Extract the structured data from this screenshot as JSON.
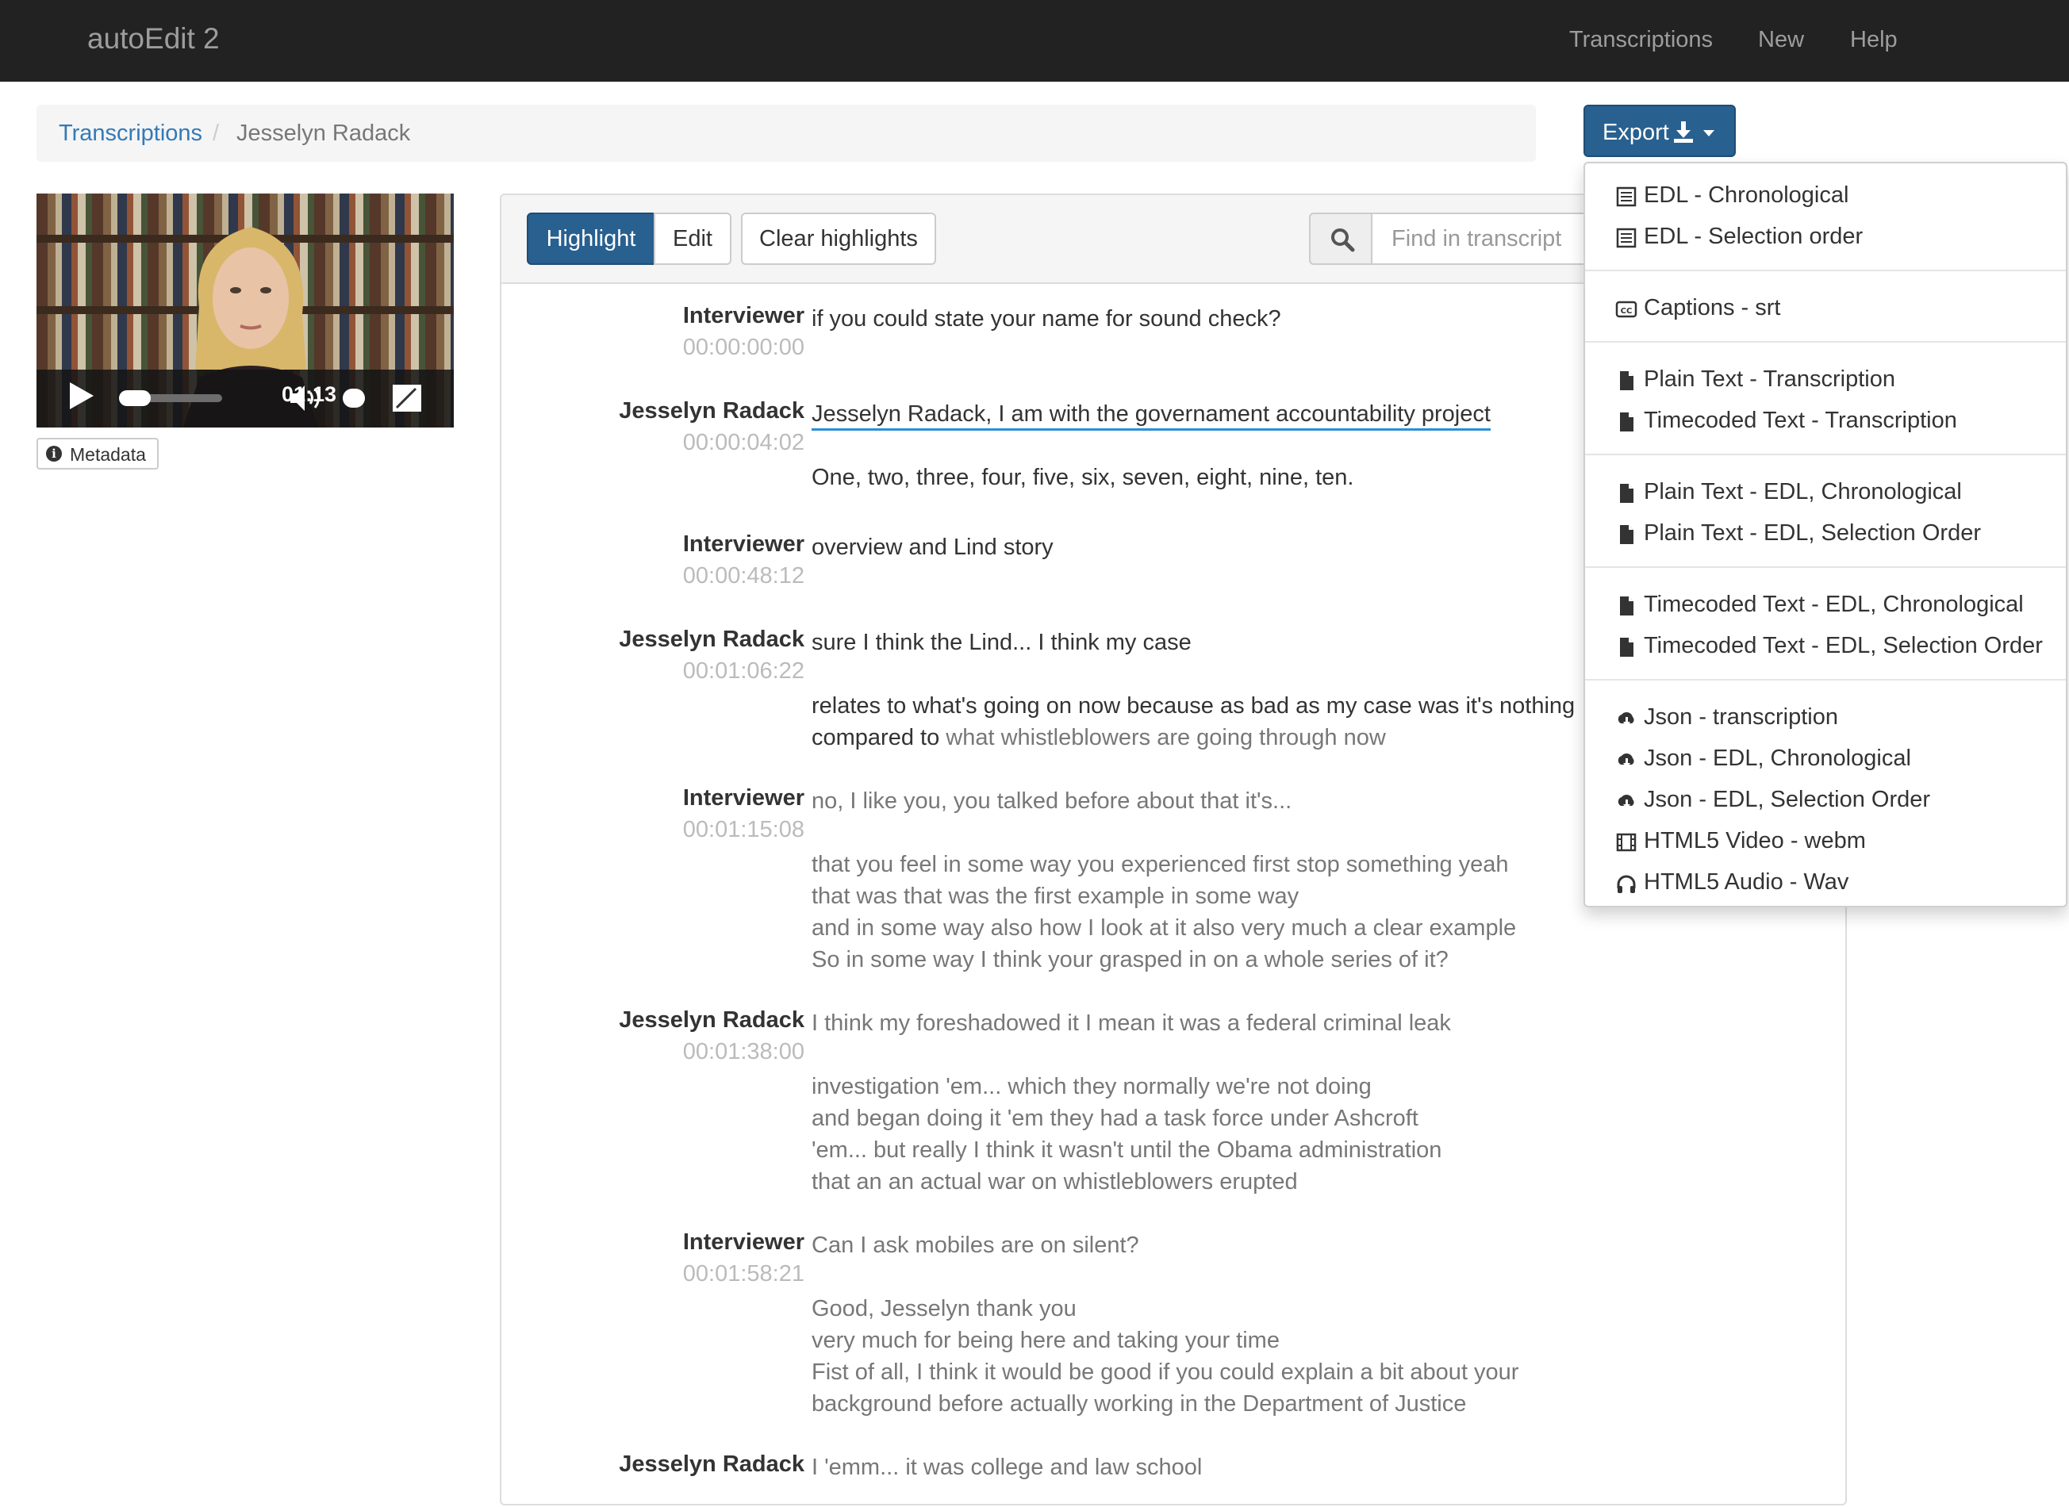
{
  "navbar": {
    "brand": "autoEdit 2",
    "links": [
      "Transcriptions",
      "New",
      "Help"
    ]
  },
  "breadcrumb": {
    "link": "Transcriptions",
    "separator": "/",
    "active": "Jesselyn Radack"
  },
  "export": {
    "label": "Export",
    "items": [
      {
        "icon": "list-icon",
        "label": "EDL - Chronological"
      },
      {
        "icon": "list-icon",
        "label": "EDL - Selection order"
      },
      {
        "icon": "captions-icon",
        "label": "Captions - srt"
      },
      {
        "icon": "file-icon",
        "label": "Plain Text - Transcription"
      },
      {
        "icon": "file-icon",
        "label": "Timecoded Text - Transcription"
      },
      {
        "icon": "file-icon",
        "label": "Plain Text - EDL, Chronological"
      },
      {
        "icon": "file-icon",
        "label": "Plain Text - EDL, Selection Order"
      },
      {
        "icon": "file-icon",
        "label": "Timecoded Text - EDL, Chronological"
      },
      {
        "icon": "file-icon",
        "label": "Timecoded Text - EDL, Selection Order"
      },
      {
        "icon": "cloud-download-icon",
        "label": "Json - transcription"
      },
      {
        "icon": "cloud-download-icon",
        "label": "Json - EDL, Chronological"
      },
      {
        "icon": "cloud-download-icon",
        "label": "Json - EDL, Selection Order"
      },
      {
        "icon": "film-icon",
        "label": "HTML5 Video - webm"
      },
      {
        "icon": "headphones-icon",
        "label": "HTML5 Audio - Wav"
      }
    ]
  },
  "video": {
    "time": "01:13"
  },
  "metadata_button": "Metadata",
  "toolbar": {
    "highlight": "Highlight",
    "edit": "Edit",
    "clear": "Clear highlights",
    "search_placeholder": "Find in transcript"
  },
  "transcript": [
    {
      "speaker": "Interviewer",
      "time": "00:00:00:00",
      "paragraphs": [
        [
          "if you could state your name for sound check?"
        ]
      ]
    },
    {
      "speaker": "Jesselyn Radack",
      "time": "00:00:04:02",
      "paragraphs": [
        [
          "Jesselyn Radack, I am with the governament accountability project"
        ],
        [
          "One, two, three, four, five, six, seven, eight, nine, ten."
        ]
      ]
    },
    {
      "speaker": "Interviewer",
      "time": "00:00:48:12",
      "paragraphs": [
        [
          "overview and Lind story"
        ]
      ]
    },
    {
      "speaker": "Jesselyn Radack",
      "time": "00:01:06:22",
      "paragraphs": [
        [
          "sure I think the Lind... I think my case"
        ],
        [
          "relates to what's going on now because as bad as my case was it's nothing",
          "compared to",
          "what whistleblowers are going through now"
        ]
      ]
    },
    {
      "speaker": "Interviewer",
      "time": "00:01:15:08",
      "paragraphs": [
        [
          "no, I like you, you talked before about that it's..."
        ],
        [
          "that you feel in some way you experienced first stop something yeah",
          "that was that was the first example in some way",
          "and in some way also how I look at it also very much a clear example",
          "So in some way I think your grasped in on a whole series of it?"
        ]
      ]
    },
    {
      "speaker": "Jesselyn Radack",
      "time": "00:01:38:00",
      "paragraphs": [
        [
          "I think my foreshadowed it I mean it was a federal criminal leak"
        ],
        [
          "investigation 'em... which they normally we're not doing",
          "and began doing it 'em they had a task force under Ashcroft",
          "'em... but really I think it wasn't until the Obama administration",
          "that an an actual war on whistleblowers erupted"
        ]
      ]
    },
    {
      "speaker": "Interviewer",
      "time": "00:01:58:21",
      "paragraphs": [
        [
          "Can I ask mobiles are on silent?"
        ],
        [
          "Good, Jesselyn thank you",
          "very much for being here and taking your time",
          "Fist of all, I think it would be good if you could explain a bit about your",
          "background before actually working in the Department of Justice"
        ]
      ]
    },
    {
      "speaker": "Jesselyn Radack",
      "time": "",
      "paragraphs": [
        [
          "I 'emm... it was college and law school"
        ]
      ]
    }
  ],
  "colors": {
    "navbar": "#222222",
    "primary": "#286090",
    "link": "#337ab7",
    "underline": "#2b8ed6",
    "timestamp": "#bbbbbb"
  }
}
